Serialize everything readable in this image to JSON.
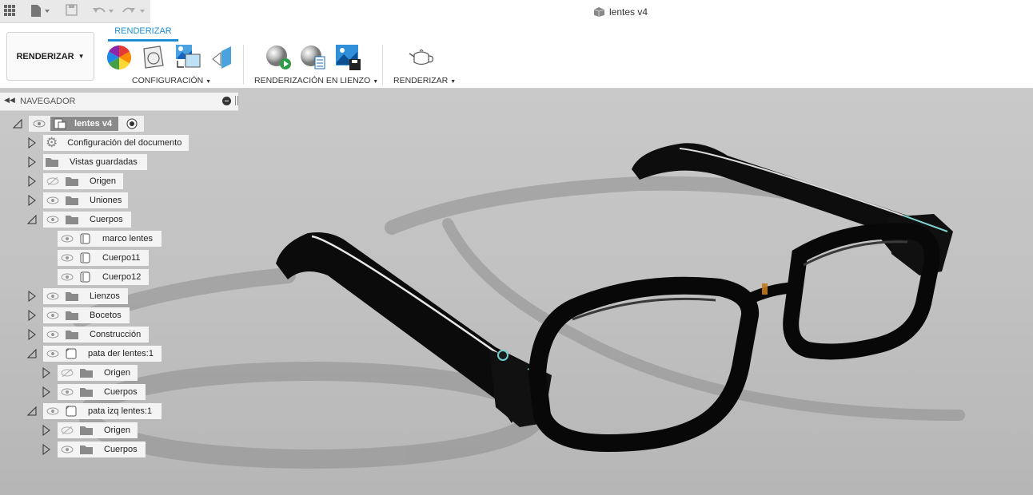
{
  "window": {
    "title": "lentes v4"
  },
  "toolbar": {
    "workspace_label": "RENDERIZAR",
    "active_tab": "RENDERIZAR",
    "groups": [
      {
        "label": "CONFIGURACIÓN"
      },
      {
        "label": "RENDERIZACIÓN EN LIENZO"
      },
      {
        "label": "RENDERIZAR"
      }
    ]
  },
  "navigator": {
    "title": "NAVEGADOR",
    "root": {
      "label": "lentes v4"
    },
    "items": [
      {
        "label": "Configuración del documento"
      },
      {
        "label": "Vistas guardadas"
      },
      {
        "label": "Origen"
      },
      {
        "label": "Uniones"
      },
      {
        "label": "Cuerpos"
      },
      {
        "label": "marco lentes"
      },
      {
        "label": "Cuerpo11"
      },
      {
        "label": "Cuerpo12"
      },
      {
        "label": "Lienzos"
      },
      {
        "label": "Bocetos"
      },
      {
        "label": "Construcción"
      },
      {
        "label": "pata der lentes:1"
      },
      {
        "label": "Origen"
      },
      {
        "label": "Cuerpos"
      },
      {
        "label": "pata izq lentes:1"
      },
      {
        "label": "Origen"
      },
      {
        "label": "Cuerpos"
      }
    ]
  },
  "colors": {
    "accent": "#1b8ed6",
    "viewport_bg": "#c2c2c2",
    "model": "#0a0a0a"
  }
}
